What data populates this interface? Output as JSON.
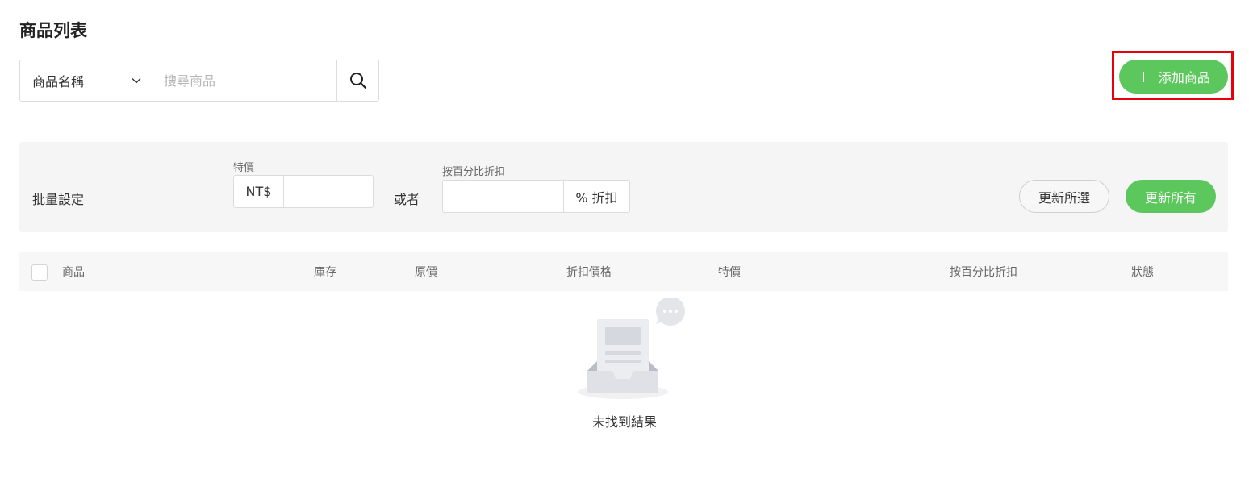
{
  "page": {
    "title": "商品列表"
  },
  "search": {
    "field_selected": "商品名稱",
    "placeholder": "搜尋商品"
  },
  "toolbar": {
    "add_button_label": "添加商品",
    "add_button_icon": "plus-icon"
  },
  "bulk": {
    "title": "批量設定",
    "special_price_label": "特價",
    "currency_prefix": "NT$",
    "or_label": "或者",
    "percent_label": "按百分比折扣",
    "percent_suffix": "% 折扣",
    "update_selected_label": "更新所選",
    "update_all_label": "更新所有"
  },
  "table": {
    "columns": [
      "商品",
      "庫存",
      "原價",
      "折扣價格",
      "特價",
      "按百分比折扣",
      "狀態"
    ]
  },
  "empty_state": {
    "message": "未找到結果",
    "icon": "empty-inbox-icon"
  },
  "colors": {
    "accent_green": "#5cc75c",
    "highlight_red": "#e8000a"
  }
}
